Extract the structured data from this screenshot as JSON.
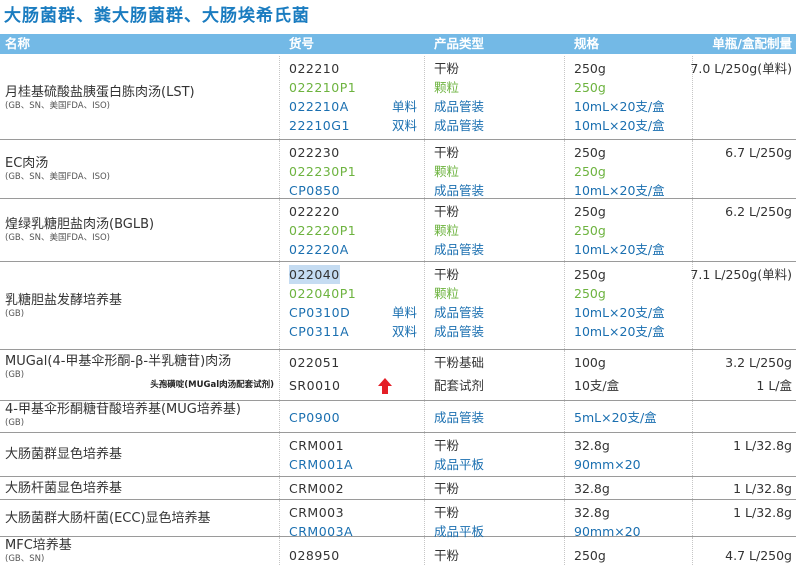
{
  "page": {
    "title": "大肠菌群、粪大肠菌群、大肠埃希氏菌"
  },
  "header": {
    "name": "名称",
    "code": "货号",
    "type": "产品类型",
    "spec": "规格",
    "unit": "单瓶/盒配制量"
  },
  "colors": {
    "accent": "#1a7cc0",
    "header_bg": "#73b9e6",
    "blue_text": "#1a6fb0",
    "green_text": "#6db33f",
    "arrow": "#e41e26"
  },
  "products": [
    {
      "name": "月桂基硫酸盐胰蛋白胨肉汤(LST)",
      "standards": "(GB、SN、美国FDA、ISO)",
      "rows": [
        {
          "code": "022210",
          "sub": "",
          "type": "干粉",
          "spec": "250g",
          "unit": "7.0 L/250g(单料)",
          "color": "dark"
        },
        {
          "code": "022210P1",
          "sub": "",
          "type": "颗粒",
          "spec": "250g",
          "unit": "",
          "color": "green"
        },
        {
          "code": "022210A",
          "sub": "单料",
          "type": "成品管装",
          "spec": "10mL×20支/盒",
          "unit": "",
          "color": "blue"
        },
        {
          "code": "22210G1",
          "sub": "双料",
          "type": "成品管装",
          "spec": "10mL×20支/盒",
          "unit": "",
          "color": "blue"
        }
      ]
    },
    {
      "name": "EC肉汤",
      "standards": "(GB、SN、美国FDA、ISO)",
      "rows": [
        {
          "code": "022230",
          "sub": "",
          "type": "干粉",
          "spec": "250g",
          "unit": "6.7 L/250g",
          "color": "dark"
        },
        {
          "code": "022230P1",
          "sub": "",
          "type": "颗粒",
          "spec": "250g",
          "unit": "",
          "color": "green"
        },
        {
          "code": "CP0850",
          "sub": "",
          "type": "成品管装",
          "spec": "10mL×20支/盒",
          "unit": "",
          "color": "blue"
        }
      ]
    },
    {
      "name": "煌绿乳糖胆盐肉汤(BGLB)",
      "standards": "(GB、SN、美国FDA、ISO)",
      "rows": [
        {
          "code": "022220",
          "sub": "",
          "type": "干粉",
          "spec": "250g",
          "unit": "6.2 L/250g",
          "color": "dark"
        },
        {
          "code": "022220P1",
          "sub": "",
          "type": "颗粒",
          "spec": "250g",
          "unit": "",
          "color": "green"
        },
        {
          "code": "022220A",
          "sub": "",
          "type": "成品管装",
          "spec": "10mL×20支/盒",
          "unit": "",
          "color": "blue"
        }
      ]
    },
    {
      "name": "乳糖胆盐发酵培养基",
      "standards": "(GB)",
      "rows": [
        {
          "code": "022040",
          "sub": "",
          "type": "干粉",
          "spec": "250g",
          "unit": "7.1 L/250g(单料)",
          "color": "dark",
          "highlight": true
        },
        {
          "code": "022040P1",
          "sub": "",
          "type": "颗粒",
          "spec": "250g",
          "unit": "",
          "color": "green"
        },
        {
          "code": "CP0310D",
          "sub": "单料",
          "type": "成品管装",
          "spec": "10mL×20支/盒",
          "unit": "",
          "color": "blue"
        },
        {
          "code": "CP0311A",
          "sub": "双料",
          "type": "成品管装",
          "spec": "10mL×20支/盒",
          "unit": "",
          "color": "blue"
        }
      ]
    },
    {
      "name": "MUGal(4-甲基伞形酮-β-半乳糖苷)肉汤",
      "standards": "(GB)",
      "rows": [
        {
          "code": "022051",
          "sub": "",
          "type": "干粉基础",
          "spec": "100g",
          "unit": "3.2 L/250g",
          "color": "dark"
        },
        {
          "code": "SR0010",
          "sub": "",
          "type": "配套试剂",
          "spec": "10支/盒",
          "unit": "1 L/盒",
          "color": "dark",
          "note": "头孢磺啶(MUGal肉汤配套试剂)",
          "arrow": true
        }
      ]
    },
    {
      "name": "4-甲基伞形酮糖苷酸培养基(MUG培养基)",
      "standards": "(GB)",
      "rows": [
        {
          "code": "CP0900",
          "sub": "",
          "type": "成品管装",
          "spec": "5mL×20支/盒",
          "unit": "",
          "color": "blue"
        }
      ]
    },
    {
      "name": "大肠菌群显色培养基",
      "standards": "",
      "rows": [
        {
          "code": "CRM001",
          "sub": "",
          "type": "干粉",
          "spec": "32.8g",
          "unit": "1 L/32.8g",
          "color": "dark"
        },
        {
          "code": "CRM001A",
          "sub": "",
          "type": "成品平板",
          "spec": "90mm×20",
          "unit": "",
          "color": "blue"
        }
      ]
    },
    {
      "name": "大肠杆菌显色培养基",
      "standards": "",
      "rows": [
        {
          "code": "CRM002",
          "sub": "",
          "type": "干粉",
          "spec": "32.8g",
          "unit": "1 L/32.8g",
          "color": "dark"
        }
      ]
    },
    {
      "name": "大肠菌群大肠杆菌(ECC)显色培养基",
      "standards": "",
      "rows": [
        {
          "code": "CRM003",
          "sub": "",
          "type": "干粉",
          "spec": "32.8g",
          "unit": "1 L/32.8g",
          "color": "dark"
        },
        {
          "code": "CRM003A",
          "sub": "",
          "type": "成品平板",
          "spec": "90mm×20",
          "unit": "",
          "color": "blue"
        }
      ]
    },
    {
      "name": "MFC培养基",
      "standards": "(GB、SN)",
      "rows": [
        {
          "code": "028950",
          "sub": "",
          "type": "干粉",
          "spec": "250g",
          "unit": "4.7 L/250g",
          "color": "dark"
        }
      ]
    }
  ]
}
